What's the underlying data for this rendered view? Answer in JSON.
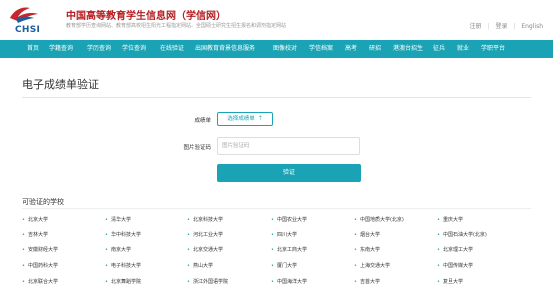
{
  "header": {
    "logo_text": "CHSI",
    "site_title": "中国高等教育学生信息网（学信网）",
    "site_subtitle": "教育部学历查询网站、教育部高校招生阳光工程指定网站、全国硕士研究生招生报名和调剂指定网站",
    "links": [
      "注册",
      "登录",
      "English"
    ]
  },
  "nav": {
    "items": [
      "首页",
      "学籍查询",
      "学历查询",
      "学位查询",
      "在线验证",
      "出国教育背景信息服务",
      "图像校对",
      "学信档案",
      "高考",
      "研招",
      "港澳台招生",
      "征兵",
      "就业",
      "学职平台"
    ]
  },
  "page": {
    "title": "电子成绩单验证"
  },
  "form": {
    "transcript_label": "成绩单",
    "select_button": "选择成绩单",
    "captcha_label": "图片验证码",
    "captcha_placeholder": "图片验证码",
    "submit_button": "验证"
  },
  "schools": {
    "heading": "可验证的学校",
    "items": [
      "北京大学",
      "清华大学",
      "北京科技大学",
      "中国农业大学",
      "中国地质大学(北京)",
      "重庆大学",
      "吉林大学",
      "华中科技大学",
      "河北工业大学",
      "四川大学",
      "烟台大学",
      "中国石油大学(北京)",
      "安徽财经大学",
      "南京大学",
      "北京交通大学",
      "北京工商大学",
      "东南大学",
      "北京理工大学",
      "中国药科大学",
      "电子科技大学",
      "燕山大学",
      "厦门大学",
      "上海交通大学",
      "中国传媒大学",
      "北京联合大学",
      "北京舞蹈学院",
      "浙江外国语学院",
      "中国海洋大学",
      "吉首大学",
      "复旦大学"
    ]
  },
  "colors": {
    "brand_red": "#b31e22",
    "accent_teal": "#1aa3b5"
  }
}
